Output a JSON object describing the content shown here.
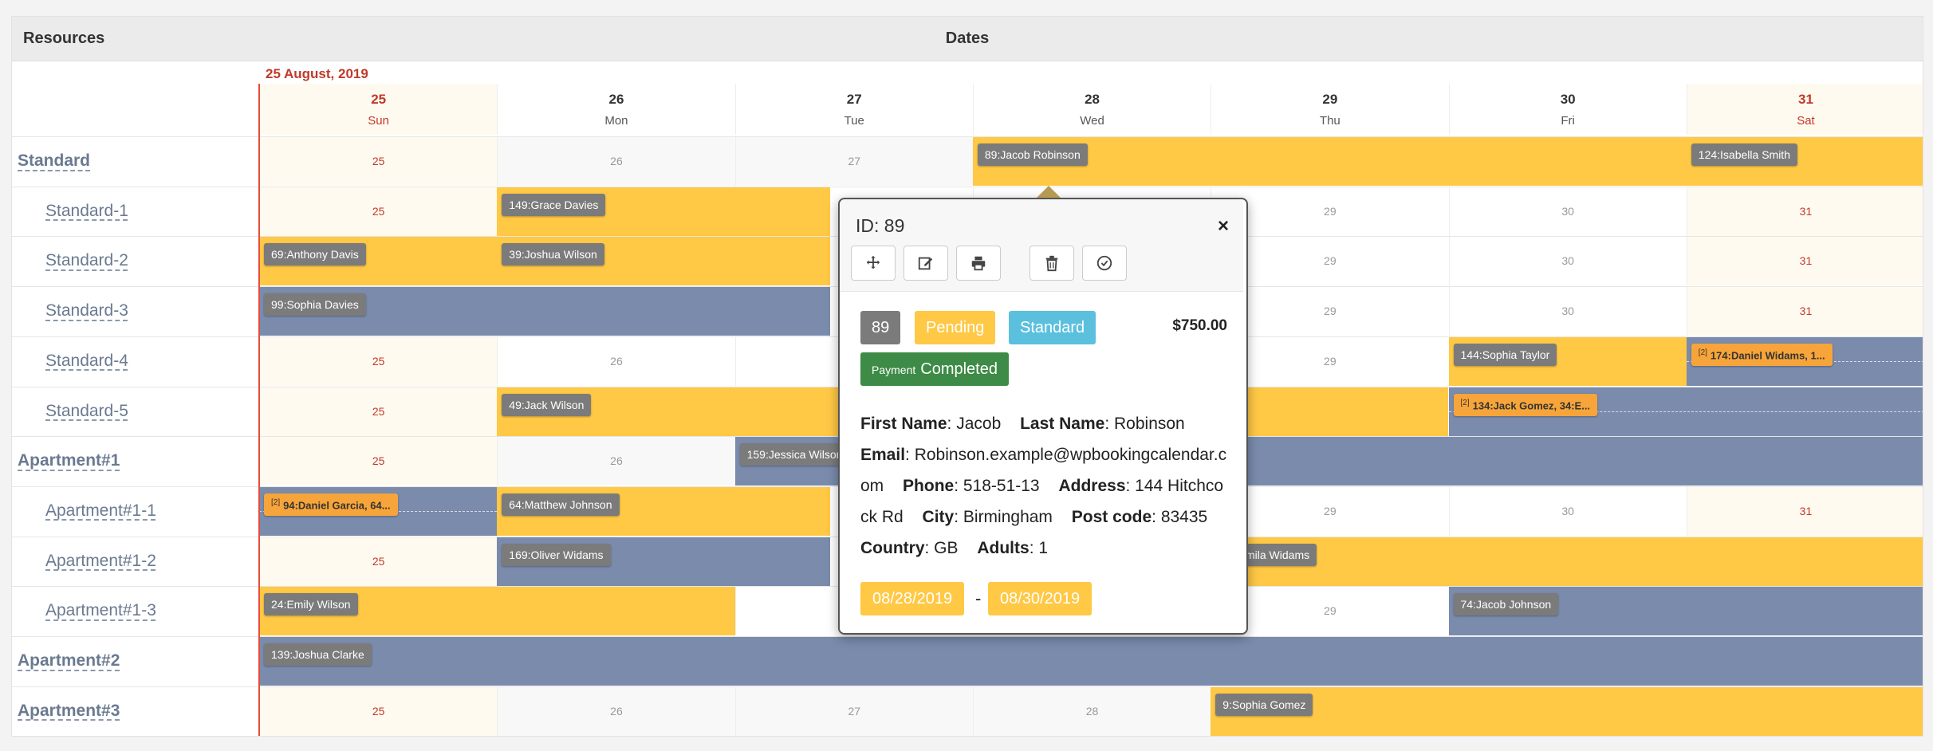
{
  "header": {
    "resources_label": "Resources",
    "dates_label": "Dates"
  },
  "month_label": "25 August, 2019",
  "days": [
    {
      "num": "25",
      "dow": "Sun",
      "kind": "today"
    },
    {
      "num": "26",
      "dow": "Mon",
      "kind": ""
    },
    {
      "num": "27",
      "dow": "Tue",
      "kind": ""
    },
    {
      "num": "28",
      "dow": "Wed",
      "kind": ""
    },
    {
      "num": "29",
      "dow": "Thu",
      "kind": ""
    },
    {
      "num": "30",
      "dow": "Fri",
      "kind": ""
    },
    {
      "num": "31",
      "dow": "Sat",
      "kind": "sat"
    }
  ],
  "rows": [
    {
      "label": "Standard",
      "group": true,
      "bookings": [
        {
          "start": 3,
          "end": 7,
          "color": "yellow",
          "tag": "89:Jacob Robinson"
        },
        {
          "start": 6,
          "end": 7,
          "color": "yellow",
          "tag": "124:Isabella Smith"
        }
      ]
    },
    {
      "label": "Standard-1",
      "group": false,
      "bookings": [
        {
          "start": 1,
          "end": 2.4,
          "color": "yellow",
          "tag": "149:Grace Davies"
        }
      ]
    },
    {
      "label": "Standard-2",
      "group": false,
      "bookings": [
        {
          "start": 0,
          "end": 1,
          "color": "yellow",
          "tag": "69:Anthony Davis"
        },
        {
          "start": 1,
          "end": 2.4,
          "color": "yellow",
          "tag": "39:Joshua Wilson"
        }
      ]
    },
    {
      "label": "Standard-3",
      "group": false,
      "bookings": [
        {
          "start": 0,
          "end": 2.4,
          "color": "blue",
          "tag": "99:Sophia Davies"
        }
      ]
    },
    {
      "label": "Standard-4",
      "group": false,
      "bookings": [
        {
          "start": 5,
          "end": 6,
          "color": "yellow",
          "tag": "144:Sophia Taylor"
        },
        {
          "start": 6,
          "end": 7,
          "color": "blue",
          "tag": "174:Daniel Widams, 1...",
          "multi": "[2]"
        }
      ]
    },
    {
      "label": "Standard-5",
      "group": false,
      "bookings": [
        {
          "start": 1,
          "end": 5,
          "color": "yellow",
          "tag": "49:Jack Wilson"
        },
        {
          "start": 5,
          "end": 7,
          "color": "blue",
          "tag": "134:Jack Gomez, 34:E...",
          "multi": "[2]"
        }
      ]
    },
    {
      "label": "Apartment#1",
      "group": true,
      "bookings": [
        {
          "start": 2,
          "end": 7,
          "color": "blue",
          "tag": "159:Jessica Wilson"
        }
      ]
    },
    {
      "label": "Apartment#1-1",
      "group": false,
      "bookings": [
        {
          "start": 0,
          "end": 1,
          "color": "blue",
          "tag": "94:Daniel Garcia, 64...",
          "multi": "[2]"
        },
        {
          "start": 1,
          "end": 2.4,
          "color": "yellow",
          "tag": "64:Matthew Johnson"
        }
      ]
    },
    {
      "label": "Apartment#1-2",
      "group": false,
      "bookings": [
        {
          "start": 1,
          "end": 2.4,
          "color": "blue",
          "tag": "169:Oliver Widams"
        },
        {
          "start": 4,
          "end": 7,
          "color": "yellow",
          "tag": "4:Kamila Widams"
        }
      ]
    },
    {
      "label": "Apartment#1-3",
      "group": false,
      "bookings": [
        {
          "start": 0,
          "end": 2,
          "color": "yellow",
          "tag": "24:Emily Wilson"
        },
        {
          "start": 5,
          "end": 7,
          "color": "blue",
          "tag": "74:Jacob Johnson"
        }
      ]
    },
    {
      "label": "Apartment#2",
      "group": true,
      "bookings": [
        {
          "start": 0,
          "end": 7,
          "color": "blue",
          "tag": "139:Joshua Clarke"
        }
      ]
    },
    {
      "label": "Apartment#3",
      "group": true,
      "bookings": [
        {
          "start": 4,
          "end": 7,
          "color": "yellow",
          "tag": "9:Sophia Gomez"
        }
      ]
    }
  ],
  "popup": {
    "id_label": "ID: 89",
    "close_glyph": "×",
    "id_badge": "89",
    "status": "Pending",
    "type": "Standard",
    "price": "$750.00",
    "payment_small": "Payment",
    "payment_status": "Completed",
    "first_name_label": "First Name",
    "first_name": "Jacob",
    "last_name_label": "Last Name",
    "last_name": "Robinson",
    "email_label": "Email",
    "email": "Robinson.example@wpbookingcalendar.com",
    "phone_label": "Phone",
    "phone": "518-51-13",
    "address_label": "Address",
    "address": "144 Hitchcock Rd",
    "city_label": "City",
    "city": "Birmingham",
    "postcode_label": "Post code",
    "postcode": "83435",
    "country_label": "Country",
    "country": "GB",
    "adults_label": "Adults",
    "adults": "1",
    "date_from": "08/28/2019",
    "date_sep": "-",
    "date_to": "08/30/2019",
    "colors": {
      "pending": "#ffc845",
      "standard": "#5bc0de",
      "id": "#7b7b7b",
      "payment": "#3d8b46"
    }
  }
}
